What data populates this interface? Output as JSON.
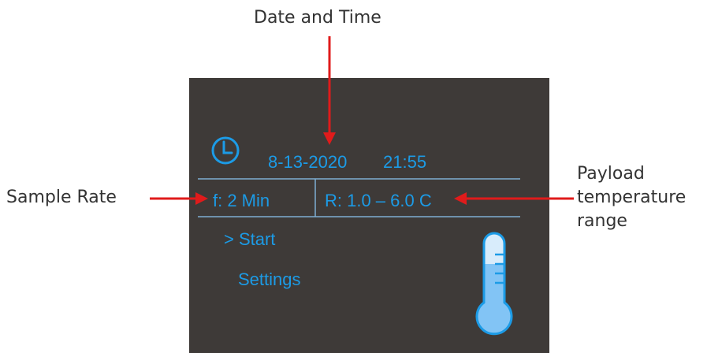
{
  "callouts": {
    "date_time": "Date and Time",
    "sample_rate": "Sample Rate",
    "payload_range_lines": [
      "Payload",
      "temperature",
      "range"
    ]
  },
  "screen": {
    "date": "8-13-2020",
    "time": "21:55",
    "sample_rate": "f: 2 Min",
    "temperature_range": "R:  1.0 – 6.0 C",
    "menu": {
      "start": "> Start",
      "settings": "Settings"
    },
    "icons": [
      "clock-icon",
      "thermometer-icon"
    ]
  },
  "colors": {
    "screen_bg": "#3e3a38",
    "text_blue": "#1c9be6",
    "divider": "#7faed3",
    "arrow_red": "#e01b1b",
    "thermometer_fill": "#82c4f5",
    "thermometer_empty": "#d8ecfb"
  }
}
